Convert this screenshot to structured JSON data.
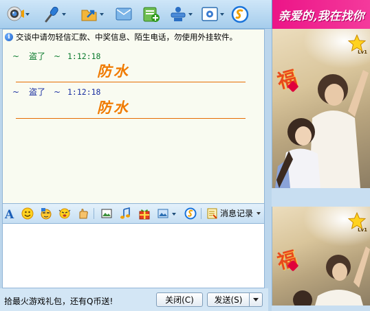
{
  "toolbar": {
    "buttons": [
      {
        "name": "video-chat-icon",
        "has_arrow": true
      },
      {
        "name": "voice-chat-icon",
        "has_arrow": true
      },
      {
        "name": "send-file-icon",
        "has_arrow": true
      },
      {
        "name": "sms-icon",
        "has_arrow": false
      },
      {
        "name": "create-group-icon",
        "has_arrow": false
      },
      {
        "name": "app-icon",
        "has_arrow": true
      },
      {
        "name": "settings-icon",
        "has_arrow": true
      },
      {
        "name": "security-icon",
        "has_arrow": false
      }
    ]
  },
  "banner": {
    "text": "亲爱的,我在找你"
  },
  "chat": {
    "notice": "交谈中请勿轻信汇款、中奖信息、陌生电话，勿使用外挂软件。",
    "messages": [
      {
        "tilde_left": "~",
        "sender": "盗了",
        "tilde_right": "~",
        "time": "1:12:18",
        "text": "防水",
        "color": "#0a7a2d"
      },
      {
        "tilde_left": "~",
        "sender": "盗了",
        "tilde_right": "~",
        "time": "1:12:18",
        "text": "防水",
        "color": "#1a2fa0"
      }
    ]
  },
  "format_bar": {
    "tools": [
      "font-icon",
      "emoticon-icon",
      "magic-emoticon-icon",
      "shake-icon",
      "hand-writing-icon",
      "screenshot-icon",
      "music-icon",
      "gift-icon",
      "image-icon",
      "security-scan-icon"
    ],
    "history_label": "消息记录"
  },
  "bottom": {
    "promo": "拾最火游戏礼包，还有Q币送!",
    "close_label": "关闭(C)",
    "send_label": "发送(S)"
  },
  "sidebar": {
    "level_badge": "Lv1",
    "fu_char": "福"
  },
  "colors": {
    "banner_pink": "#ec1487",
    "message_text": "#f07a00",
    "message_rule": "#e66b00"
  }
}
